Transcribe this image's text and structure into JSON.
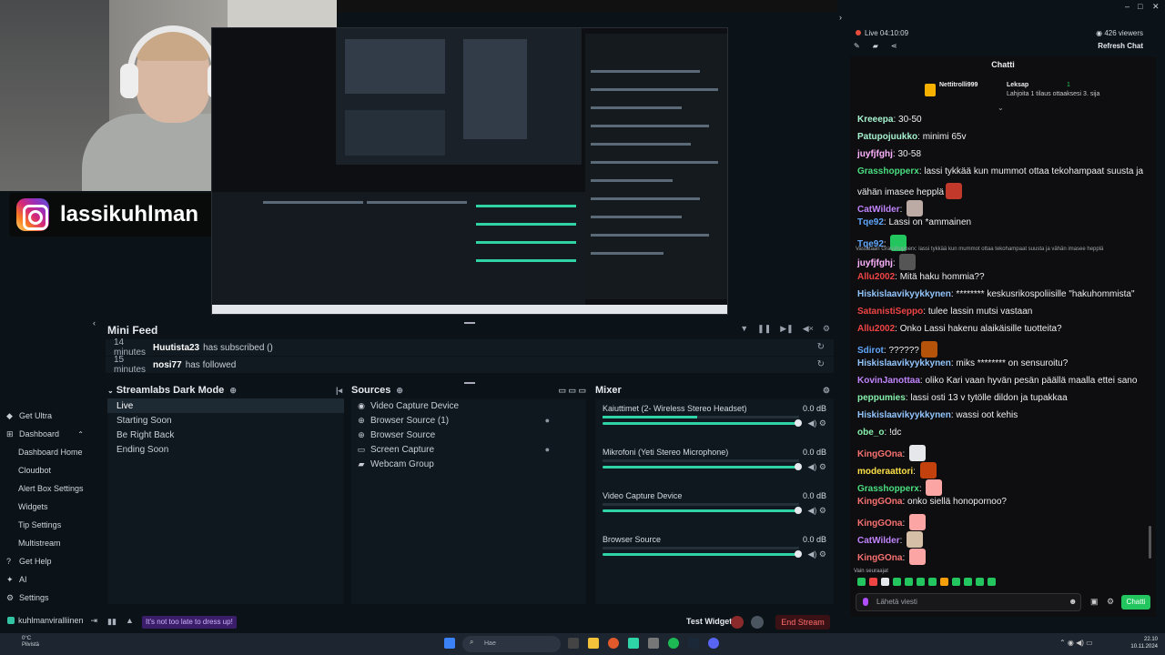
{
  "overlay": {
    "instagram_handle": "lassikuhlman"
  },
  "mini_feed": {
    "title": "Mini Feed",
    "events": [
      {
        "time": "14 minutes",
        "user": "Huutista23",
        "text": "has subscribed ()"
      },
      {
        "time": "15 minutes",
        "user": "nosi77",
        "text": "has followed"
      }
    ]
  },
  "scenes": {
    "title": "Streamlabs Dark Mode",
    "items": [
      "Live",
      "Starting Soon",
      "Be Right Back",
      "Ending Soon"
    ]
  },
  "sources": {
    "title": "Sources",
    "items": [
      "Video Capture Device",
      "Browser Source (1)",
      "Browser Source",
      "Screen Capture",
      "Webcam Group"
    ]
  },
  "mixer": {
    "title": "Mixer",
    "channels": [
      {
        "name": "Kaiuttimet (2- Wireless Stereo Headset)",
        "db": "0.0 dB",
        "level": 0.48
      },
      {
        "name": "Mikrofoni (Yeti Stereo Microphone)",
        "db": "0.0 dB",
        "level": 0
      },
      {
        "name": "Video Capture Device",
        "db": "0.0 dB",
        "level": 0
      },
      {
        "name": "Browser Source",
        "db": "0.0 dB",
        "level": 0
      }
    ]
  },
  "nav": {
    "items": [
      {
        "label": "Get Ultra",
        "icon": "ultra-icon",
        "sub": false
      },
      {
        "label": "Dashboard",
        "icon": "dashboard-icon",
        "sub": false
      },
      {
        "label": "Dashboard Home",
        "sub": true
      },
      {
        "label": "Cloudbot",
        "sub": true
      },
      {
        "label": "Alert Box Settings",
        "sub": true
      },
      {
        "label": "Widgets",
        "sub": true
      },
      {
        "label": "Tip Settings",
        "sub": true
      },
      {
        "label": "Multistream",
        "sub": true
      },
      {
        "label": "Get Help",
        "icon": "help-icon",
        "sub": false
      },
      {
        "label": "AI",
        "icon": "ai-icon",
        "sub": false
      },
      {
        "label": "Settings",
        "icon": "gear-icon",
        "sub": false
      }
    ]
  },
  "statusbar": {
    "username": "kuhlmanviralliinen",
    "promo": "It's not too late to dress up!",
    "test_widgets": "Test Widgets",
    "end_stream": "End Stream"
  },
  "chat": {
    "live_time": "Live 04:10:09",
    "viewers": "426 viewers",
    "refresh": "Refresh Chat",
    "title": "Chatti",
    "pinned_user": "Nettitrolli999",
    "pinned_target": "Leksap",
    "pinned_count": "1",
    "pinned_text": "Lahjoita 1 tilaus ottaaksesi 3. sija",
    "reply_note": "Vastataan Grasshopperx: lassi tykkää kun mummot ottaa tekohampaat suusta ja vähän imasee hepplä",
    "follow_note": "Vain seuraajat",
    "input_placeholder": "Lähetä viesti",
    "send_label": "Chatti",
    "messages": [
      {
        "user": "Kreeepa",
        "color": "#a7f3d0",
        "text": "30-50",
        "emote": ""
      },
      {
        "user": "Patupojuukko",
        "color": "#a7f3d0",
        "text": "minimi 65v",
        "emote": ""
      },
      {
        "user": "juyfjfghj",
        "color": "#ffb3ff",
        "text": "30-58",
        "emote": ""
      },
      {
        "user": "Grasshopperx",
        "color": "#4ade80",
        "text": "lassi tykkää kun mummot ottaa tekohampaat suusta ja",
        "emote": ""
      },
      {
        "user": "",
        "color": "#efeff1",
        "text": "vähän imasee hepplä",
        "emote": "#c0392b"
      },
      {
        "user": "CatWilder",
        "color": "#c084fc",
        "text": "",
        "emote": "#bcaaa4"
      },
      {
        "user": "Tqe92",
        "color": "#60a5fa",
        "text": "Lassi on *ammainen",
        "emote": ""
      },
      {
        "user": "Tqe92",
        "color": "#60a5fa",
        "text": "",
        "emote": "#22c55e"
      },
      {
        "user": "juyfjfghj",
        "color": "#ffb3ff",
        "text": "",
        "emote": "#555"
      },
      {
        "user": "Allu2002",
        "color": "#ef4444",
        "text": "Mitä haku hommia??",
        "emote": ""
      },
      {
        "user": "Hiskislaavikyykkynen",
        "color": "#93c5fd",
        "text": "******** keskusrikospoliisille \"hakuhommista\"",
        "emote": ""
      },
      {
        "user": "SatanistiSeppo",
        "color": "#ef4444",
        "text": "tulee lassin mutsi vastaan",
        "emote": ""
      },
      {
        "user": "Allu2002",
        "color": "#ef4444",
        "text": "Onko Lassi hakenu alaikäisille tuotteita?",
        "emote": ""
      },
      {
        "user": "Sdirot",
        "color": "#60a5fa",
        "text": "??????",
        "emote": "#b45309"
      },
      {
        "user": "Hiskislaavikyykkynen",
        "color": "#93c5fd",
        "text": "miks ******** on sensuroitu?",
        "emote": ""
      },
      {
        "user": "KovinJanottaa",
        "color": "#c084fc",
        "text": "oliko Kari vaan hyvän pesän päällä maalla ettei sano",
        "emote": ""
      },
      {
        "user": "peppumies",
        "color": "#86efac",
        "text": "lassi osti 13 v tytölle dildon ja tupakkaa",
        "emote": ""
      },
      {
        "user": "Hiskislaavikyykkynen",
        "color": "#93c5fd",
        "text": "wassi oot kehis",
        "emote": ""
      },
      {
        "user": "obe_o",
        "color": "#86efac",
        "text": "!dc",
        "emote": ""
      },
      {
        "user": "KingGOna",
        "color": "#f87171",
        "text": "",
        "emote": "#e5e7eb"
      },
      {
        "user": "moderaattori",
        "color": "#fde047",
        "text": "",
        "emote": "#c2410c"
      },
      {
        "user": "Grasshopperx",
        "color": "#4ade80",
        "text": "",
        "emote": "#fca5a5"
      },
      {
        "user": "KingGOna",
        "color": "#f87171",
        "text": "onko siellä honopornoo?",
        "emote": ""
      },
      {
        "user": "KingGOna",
        "color": "#f87171",
        "text": "",
        "emote": "#fca5a5"
      },
      {
        "user": "CatWilder",
        "color": "#c084fc",
        "text": "",
        "emote": "#d6bfa7"
      },
      {
        "user": "KingGOna",
        "color": "#f87171",
        "text": "",
        "emote": "#fca5a5"
      }
    ]
  },
  "taskbar": {
    "weather_temp": "0°C",
    "weather_desc": "Pilvistä",
    "search_placeholder": "Hae",
    "time": "22.10",
    "date": "10.11.2024"
  },
  "colors": {
    "accent": "#31c3a2",
    "chat_send": "#22c55e",
    "end_stream": "#ff6b6b"
  }
}
